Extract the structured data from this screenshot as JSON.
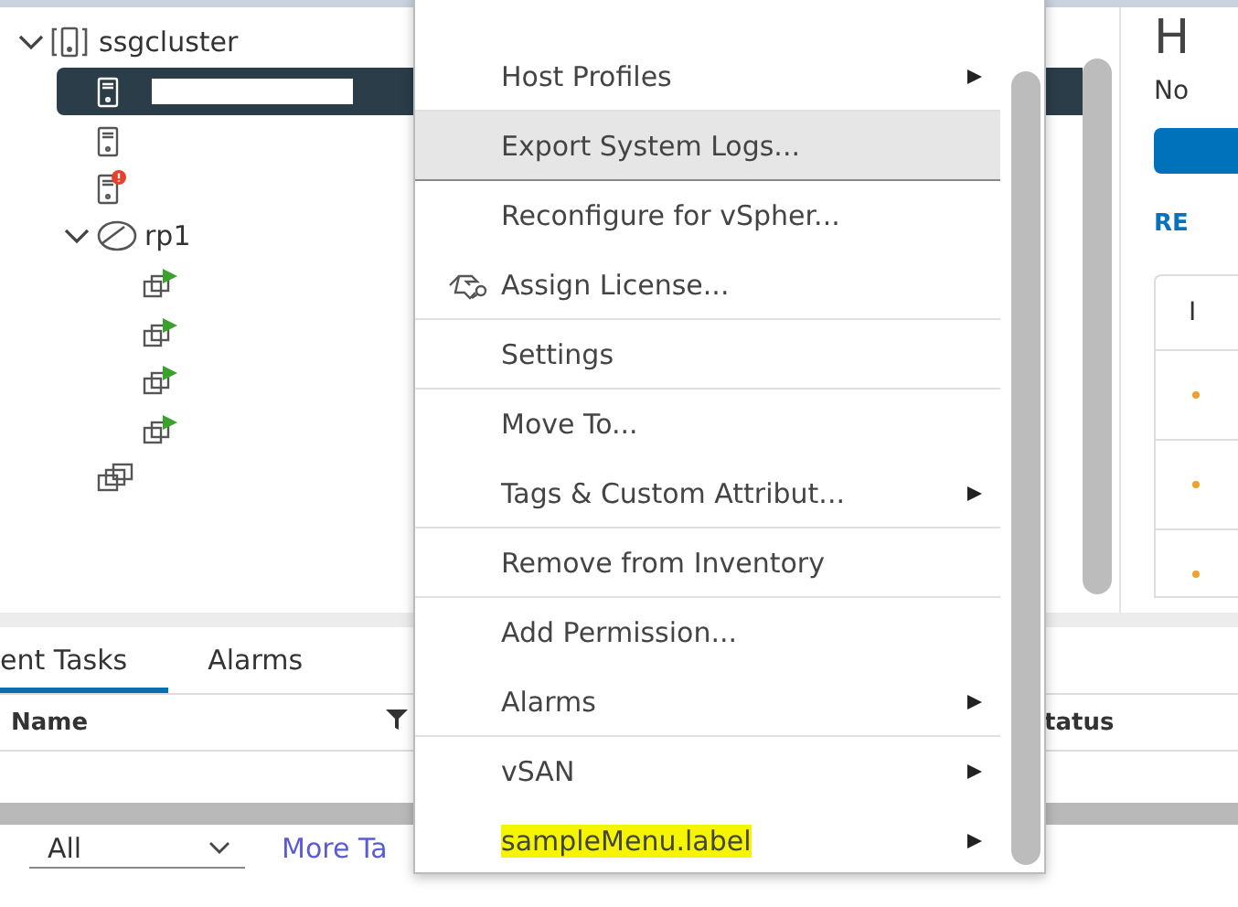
{
  "tree": [
    {
      "kind": "cluster",
      "label": "ssgcluster",
      "expanded": true,
      "selected": false,
      "children": [
        {
          "kind": "host",
          "selected": true,
          "alert": false
        },
        {
          "kind": "host",
          "selected": false,
          "alert": false
        },
        {
          "kind": "host",
          "selected": false,
          "alert": true
        },
        {
          "kind": "resource-pool",
          "label": "rp1",
          "expanded": true,
          "selected": false,
          "children": [
            {
              "kind": "vm",
              "selected": false,
              "running": true
            },
            {
              "kind": "vm",
              "selected": false,
              "running": true
            },
            {
              "kind": "vm",
              "selected": false,
              "running": true
            },
            {
              "kind": "vm",
              "selected": false,
              "running": true
            }
          ]
        },
        {
          "kind": "vapp",
          "selected": false
        }
      ]
    }
  ],
  "context_menu": {
    "items": [
      {
        "label": "Host Profiles",
        "submenu": true,
        "hovered": false,
        "highlighted": false,
        "icon": false,
        "separator": true
      },
      {
        "label": "Export System Logs...",
        "submenu": false,
        "hovered": true,
        "highlighted": false,
        "icon": false,
        "separator": true
      },
      {
        "label": "Reconfigure for vSpher...",
        "submenu": false,
        "hovered": false,
        "highlighted": false,
        "icon": false,
        "separator": false
      },
      {
        "label": "Assign License...",
        "submenu": false,
        "hovered": false,
        "highlighted": false,
        "icon": true,
        "separator": true
      },
      {
        "label": "Settings",
        "submenu": false,
        "hovered": false,
        "highlighted": false,
        "icon": false,
        "separator": true
      },
      {
        "label": "Move To...",
        "submenu": false,
        "hovered": false,
        "highlighted": false,
        "icon": false,
        "separator": false
      },
      {
        "label": "Tags & Custom Attribut...",
        "submenu": true,
        "hovered": false,
        "highlighted": false,
        "icon": false,
        "separator": true
      },
      {
        "label": "Remove from Inventory",
        "submenu": false,
        "hovered": false,
        "highlighted": false,
        "icon": false,
        "separator": true
      },
      {
        "label": "Add Permission...",
        "submenu": false,
        "hovered": false,
        "highlighted": false,
        "icon": false,
        "separator": false
      },
      {
        "label": "Alarms",
        "submenu": true,
        "hovered": false,
        "highlighted": false,
        "icon": false,
        "separator": true
      },
      {
        "label": "vSAN",
        "submenu": true,
        "hovered": false,
        "highlighted": false,
        "icon": false,
        "separator": false
      },
      {
        "label": "sampleMenu.label",
        "submenu": true,
        "hovered": false,
        "highlighted": true,
        "icon": false,
        "separator": false
      }
    ]
  },
  "right_panel": {
    "heading": "H",
    "subtitle": "No",
    "link": "RE",
    "table_header": "I"
  },
  "bottom_panel": {
    "tabs": [
      {
        "label": "ent Tasks",
        "selected": true
      },
      {
        "label": "Alarms",
        "selected": false
      }
    ],
    "columns": [
      "Name",
      "tatus"
    ],
    "filter": "All",
    "more_link": "More Ta"
  }
}
